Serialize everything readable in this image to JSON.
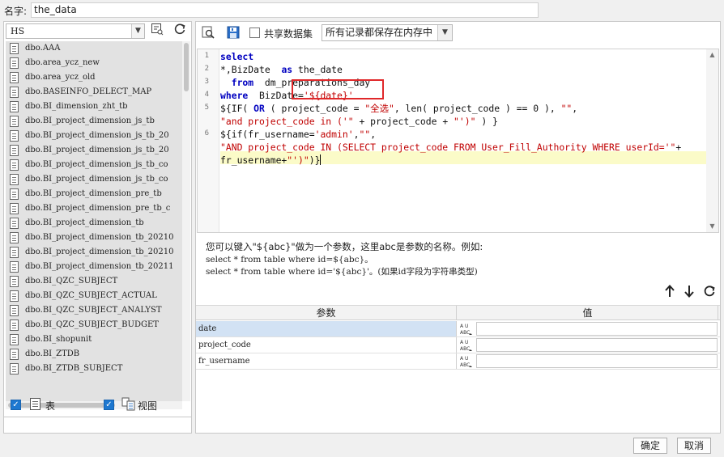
{
  "dataset_name": {
    "label": "名字:",
    "value": "the_data"
  },
  "left": {
    "database": "HS",
    "tables": [
      "dbo.AAA",
      "dbo.area_ycz_new",
      "dbo.area_ycz_old",
      "dbo.BASEINFO_DELECT_MAP",
      "dbo.BI_dimension_zht_tb",
      "dbo.BI_project_dimension_js_tb",
      "dbo.BI_project_dimension_js_tb_20",
      "dbo.BI_project_dimension_js_tb_20",
      "dbo.BI_project_dimension_js_tb_co",
      "dbo.BI_project_dimension_js_tb_co",
      "dbo.BI_project_dimension_pre_tb",
      "dbo.BI_project_dimension_pre_tb_c",
      "dbo.BI_project_dimension_tb",
      "dbo.BI_project_dimension_tb_20210",
      "dbo.BI_project_dimension_tb_20210",
      "dbo.BI_project_dimension_tb_20211",
      "dbo.BI_QZC_SUBJECT",
      "dbo.BI_QZC_SUBJECT_ACTUAL",
      "dbo.BI_QZC_SUBJECT_ANALYST",
      "dbo.BI_QZC_SUBJECT_BUDGET",
      "dbo.BI_shopunit",
      "dbo.BI_ZTDB",
      "dbo.BI_ZTDB_SUBJECT"
    ],
    "show_tables_label": "表",
    "show_views_label": "视图"
  },
  "toolbar": {
    "share_label": "共享数据集",
    "memory_option": "所有记录都保存在内存中"
  },
  "sql_lines": [
    {
      "num": "1",
      "parts": [
        {
          "t": "select",
          "c": "kw"
        }
      ]
    },
    {
      "num": "2",
      "parts": [
        {
          "t": "*,BizDate  ",
          "c": "pl"
        },
        {
          "t": "as",
          "c": "kw"
        },
        {
          "t": " the_date",
          "c": "pl"
        }
      ]
    },
    {
      "num": "3",
      "parts": [
        {
          "t": "  ",
          "c": "pl"
        },
        {
          "t": "from",
          "c": "kw"
        },
        {
          "t": "  dm_preparations_day",
          "c": "pl"
        }
      ]
    },
    {
      "num": "4",
      "parts": [
        {
          "t": "where",
          "c": "kw"
        },
        {
          "t": "  BizDate=",
          "c": "pl"
        },
        {
          "t": "'${date}'",
          "c": "str"
        }
      ]
    },
    {
      "num": "5",
      "parts": [
        {
          "t": "${IF( ",
          "c": "pl"
        },
        {
          "t": "OR",
          "c": "kw"
        },
        {
          "t": " ( project_code = ",
          "c": "pl"
        },
        {
          "t": "\"全选\"",
          "c": "str"
        },
        {
          "t": ", len( project_code ) == 0 ), ",
          "c": "pl"
        },
        {
          "t": "\"\"",
          "c": "str"
        },
        {
          "t": ",",
          "c": "pl"
        }
      ]
    },
    {
      "num": "",
      "parts": [
        {
          "t": "\"and project_code in ('\"",
          "c": "str"
        },
        {
          "t": " + project_code + ",
          "c": "pl"
        },
        {
          "t": "\"')\"",
          "c": "str"
        },
        {
          "t": " ) }",
          "c": "pl"
        }
      ]
    },
    {
      "num": "6",
      "parts": [
        {
          "t": "${if(fr_username=",
          "c": "pl"
        },
        {
          "t": "'admin'",
          "c": "str"
        },
        {
          "t": ",",
          "c": "pl"
        },
        {
          "t": "\"\"",
          "c": "str"
        },
        {
          "t": ",",
          "c": "pl"
        }
      ]
    },
    {
      "num": "",
      "parts": [
        {
          "t": "\"AND project_code IN (SELECT project_code FROM User_Fill_Authority WHERE userId='\"",
          "c": "str"
        },
        {
          "t": "+",
          "c": "pl"
        }
      ]
    },
    {
      "num": "",
      "parts": [
        {
          "t": "fr_username+",
          "c": "pl"
        },
        {
          "t": "\"')\"",
          "c": "str"
        },
        {
          "t": ")}",
          "c": "pl"
        }
      ]
    }
  ],
  "help": {
    "line1": "您可以键入\"${abc}\"做为一个参数，这里abc是参数的名称。例如:",
    "line2": "select * from table where id=${abc}。",
    "line3": "select * from table where id='${abc}'。(如果id字段为字符串类型)"
  },
  "params": {
    "col_param": "参数",
    "col_value": "值",
    "rows": [
      {
        "name": "date",
        "value": ""
      },
      {
        "name": "project_code",
        "value": ""
      },
      {
        "name": "fr_username",
        "value": ""
      }
    ]
  },
  "buttons": {
    "ok": "确定",
    "cancel": "取消"
  }
}
